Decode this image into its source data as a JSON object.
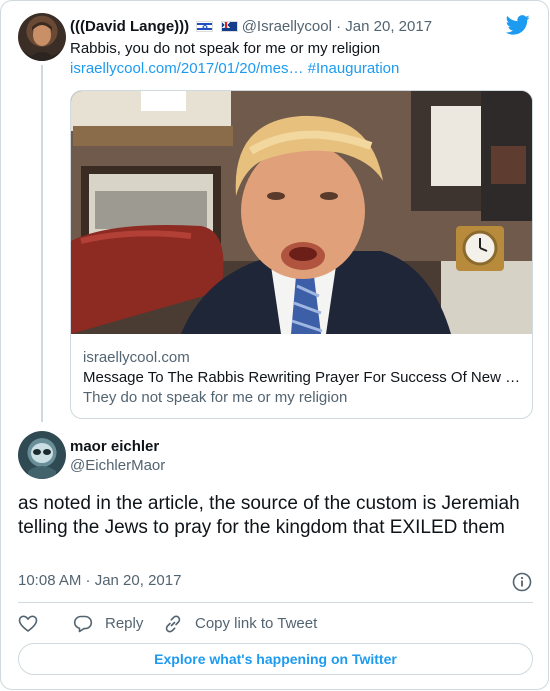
{
  "parent_tweet": {
    "name": "(((David Lange)))",
    "flags": [
      "israel-flag",
      "australia-flag"
    ],
    "handle": "@Israellycool",
    "separator": "·",
    "date": "Jan 20, 2017",
    "text": "Rabbis, you do not speak for me or my religion",
    "link_text": "israellycool.com/2017/01/20/mes…",
    "hashtag": "#Inauguration",
    "link_card": {
      "domain": "israellycool.com",
      "title": "Message To The Rabbis Rewriting Prayer For Success Of New …",
      "description": "They do not speak for me or my religion"
    }
  },
  "main_tweet": {
    "name": "maor eichler",
    "handle": "@EichlerMaor",
    "text": "as noted in the article, the source of the custom is Jeremiah telling the Jews to pray for the kingdom that EXILED them",
    "timestamp": "10:08 AM · Jan 20, 2017"
  },
  "actions": {
    "like_icon": "heart-icon",
    "reply_label": "Reply",
    "copy_label": "Copy link to Tweet"
  },
  "explore_label": "Explore what's happening on Twitter",
  "colors": {
    "accent": "#1d9bf0",
    "text": "#0f1419",
    "secondary": "#536471",
    "border": "#cfd9de"
  }
}
